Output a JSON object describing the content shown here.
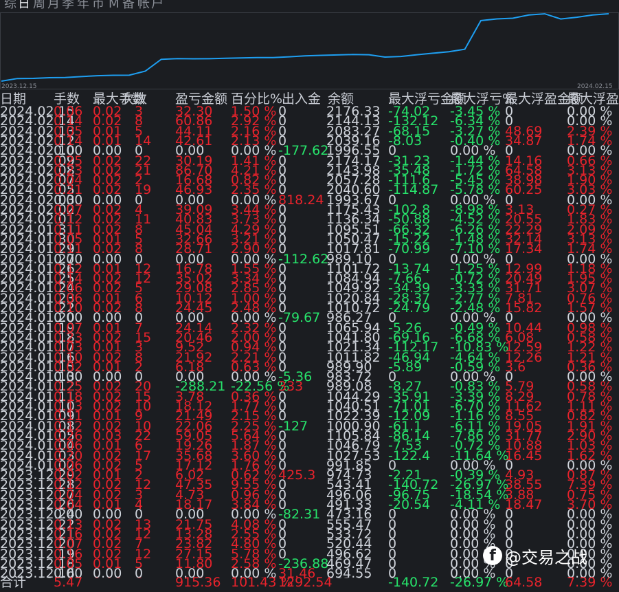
{
  "tabs": [
    "综",
    "日",
    "周",
    "月",
    "季",
    "年",
    "币",
    "M",
    "备",
    "帐",
    "户"
  ],
  "active_tab": 1,
  "chart": {
    "x_start": "2023.12.15",
    "x_end": "2024.02.15",
    "line_color": "#1e9ff2",
    "values": [
      400,
      469,
      473,
      491,
      496,
      520,
      543,
      554,
      555,
      663,
      974,
      992,
      989,
      990,
      1001,
      1010,
      1020,
      1021,
      1042,
      1065,
      1080,
      1090,
      1101,
      1095,
      1035,
      1050,
      1095,
      1136,
      1175,
      1240,
      1994,
      2040,
      2058,
      2144,
      2174,
      2039,
      2083,
      2144,
      2176
    ]
  },
  "headers": [
    "日期",
    "手数",
    "最大手数",
    "次数",
    "盈亏金额",
    "百分比%",
    "出入金",
    "余额",
    "最大浮亏金额",
    "最大浮亏%",
    "最大浮盈金额",
    "最大浮盈%"
  ],
  "colors": {
    "profit": "#e8232c",
    "loss": "#27e36b",
    "neutral": "#cfd3da",
    "background": "#1b1d21"
  },
  "rows": [
    [
      "2024.02.15",
      "0.06",
      "0.02",
      "3",
      "32.30",
      "1.50 %",
      "0",
      "2176.33",
      "-74.02",
      "-3.45 %",
      "0",
      "0.00 %"
    ],
    [
      "2024.02.14",
      "0.14",
      "0.02",
      "8",
      "60.86",
      "2.92 %",
      "0",
      "2144.13",
      "-132.12",
      "-6.34 %",
      "0",
      "0.00 %"
    ],
    [
      "2024.02.13",
      "0.05",
      "0.01",
      "5",
      "44.11",
      "2.16 %",
      "0",
      "2083.27",
      "-68.15",
      "-3.27 %",
      "48.69",
      "2.39 %"
    ],
    [
      "2024.02.12",
      "0.14",
      "0.01",
      "14",
      "42.61",
      "2.13 %",
      "0",
      "2039.16",
      "-8.03",
      "-0.40 %",
      "34.87",
      "1.74 %"
    ],
    [
      "2024.02.10",
      "0.00",
      "0.00",
      "0",
      "0.00",
      "0.00 %",
      "-177.62",
      "1996.55",
      "0",
      "0.00 %",
      "0",
      "0.00 %"
    ],
    [
      "2024.02.09",
      "0.25",
      "0.02",
      "22",
      "30.19",
      "1.41 %",
      "0",
      "2174.17",
      "-31.23",
      "-1.44 %",
      "14.16",
      "0.66 %"
    ],
    [
      "2024.02.08",
      "0.23",
      "0.02",
      "21",
      "86.70",
      "4.21 %",
      "0",
      "2143.98",
      "-35.48",
      "-1.72 %",
      "64.58",
      "3.13 %"
    ],
    [
      "2024.02.07",
      "0.04",
      "0.02",
      "2",
      "16.68",
      "0.82 %",
      "0",
      "2057.28",
      "-111.6",
      "-5.45 %",
      "38.98",
      "1.90 %"
    ],
    [
      "2024.02.05",
      "0.21",
      "0.02",
      "19",
      "46.93",
      "2.35 %",
      "0",
      "2040.60",
      "-114.87",
      "-5.78 %",
      "60.25",
      "3.03 %"
    ],
    [
      "2024.02.03",
      "0.00",
      "0.00",
      "0",
      "0.00",
      "0.00 %",
      "818.24",
      "1993.67",
      "0",
      "0.00 %",
      "0",
      "0.00 %"
    ],
    [
      "2024.02.02",
      "0.07",
      "0.02",
      "4",
      "39.09",
      "3.44 %",
      "0",
      "1175.43",
      "-102.8",
      "-8.98 %",
      "3.13",
      "0.27 %"
    ],
    [
      "2024.02.01",
      "0.12",
      "0.02",
      "11",
      "40.83",
      "3.73 %",
      "0",
      "1136.34",
      "-50.88",
      "-4.52 %",
      "20.55",
      "1.83 %"
    ],
    [
      "2024.01.31",
      "0.11",
      "0.02",
      "8",
      "45.04",
      "4.29 %",
      "0",
      "1095.51",
      "-66.32",
      "-6.26 %",
      "22.29",
      "2.09 %"
    ],
    [
      "2024.01.30",
      "0.05",
      "0.01",
      "5",
      "32.66",
      "3.21 %",
      "0",
      "1050.47",
      "-15.22",
      "-1.48 %",
      "32.14",
      "3.13 %"
    ],
    [
      "2024.01.29",
      "0.11",
      "0.02",
      "8",
      "28.71",
      "2.90 %",
      "0",
      "1017.81",
      "-70.99",
      "-7.10 %",
      "17.34",
      "1.74 %"
    ],
    [
      "2024.01.27",
      "0.00",
      "0.00",
      "0",
      "0.00",
      "0.00 %",
      "-112.62",
      "989.10",
      "0",
      "0.00 %",
      "0",
      "0.00 %"
    ],
    [
      "2024.01.26",
      "0.12",
      "0.01",
      "12",
      "16.78",
      "1.55 %",
      "0",
      "1101.72",
      "-13.74",
      "-1.25 %",
      "12.99",
      "1.18 %"
    ],
    [
      "2024.01.25",
      "0.14",
      "0.02",
      "12",
      "35.02",
      "3.34 %",
      "0",
      "1084.94",
      "-7.66",
      "-0.72 %",
      "20.49",
      "1.95 %"
    ],
    [
      "2024.01.24",
      "0.06",
      "0.02",
      "5",
      "29.08",
      "2.85 %",
      "0",
      "1049.92",
      "-34.39",
      "-3.33 %",
      "31.71",
      "3.07 %"
    ],
    [
      "2024.01.23",
      "0.06",
      "0.01",
      "6",
      "10.12",
      "1.00 %",
      "0",
      "1020.84",
      "-28.37",
      "-2.77 %",
      "7.81",
      "0.76 %"
    ],
    [
      "2024.01.22",
      "0.10",
      "0.02",
      "8",
      "24.45",
      "2.48 %",
      "0",
      "1010.72",
      "-24.79",
      "-2.48 %",
      "15.82",
      "1.57 %"
    ],
    [
      "2024.01.20",
      "0.00",
      "0.00",
      "0",
      "0.00",
      "0.00 %",
      "-79.67",
      "986.27",
      "0",
      "0.00 %",
      "0",
      "0.00 %"
    ],
    [
      "2024.01.19",
      "0.07",
      "0.01",
      "7",
      "24.14",
      "2.32 %",
      "0",
      "1065.94",
      "-5.26",
      "-0.49 %",
      "10.44",
      "0.98 %"
    ],
    [
      "2024.01.18",
      "0.23",
      "0.02",
      "15",
      "20.46",
      "2.00 %",
      "0",
      "1041.80",
      "-69.16",
      "-6.68 %",
      "6.08",
      "0.58 %"
    ],
    [
      "2024.01.17",
      "0.03",
      "0.01",
      "3",
      "9.52",
      "0.94 %",
      "0",
      "1021.34",
      "-112.17",
      "-10.83 %",
      "12.59",
      "1.22 %"
    ],
    [
      "2024.01.16",
      "0.10",
      "0.02",
      "8",
      "21.92",
      "2.21 %",
      "0",
      "1011.82",
      "-46.94",
      "-4.64 %",
      "12.26",
      "1.21 %"
    ],
    [
      "2024.01.15",
      "0.02",
      "0.01",
      "2",
      "6.18",
      "0.63 %",
      "0",
      "989.90",
      "-5.89",
      "-0.59 %",
      "3.6",
      "0.36 %"
    ],
    [
      "2024.01.13",
      "0.00",
      "0.00",
      "0",
      "0.00",
      "0.00 %",
      "-5.36",
      "983.72",
      "0",
      "0.00 %",
      "0",
      "0.00 %"
    ],
    [
      "2024.01.12",
      "0.25",
      "0.02",
      "20",
      "-288.21",
      "-22.56 %",
      "333",
      "989.08",
      "-8.27",
      "-0.83 %",
      "5.79",
      "0.58 %"
    ],
    [
      "2024.01.11",
      "0.18",
      "0.02",
      "15",
      "3.78",
      "0.36 %",
      "0",
      "1044.29",
      "-35.91",
      "-3.39 %",
      "8.29",
      "0.78 %"
    ],
    [
      "2024.01.10",
      "0.13",
      "0.02",
      "10",
      "18.12",
      "1.77 %",
      "0",
      "1040.51",
      "-71.01",
      "-6.70 %",
      "11.62",
      "1.11 %"
    ],
    [
      "2024.01.09",
      "0.11",
      "0.01",
      "9",
      "21.49",
      "2.15 %",
      "0",
      "1022.39",
      "-12.09",
      "-1.16 %",
      "8.55",
      "0.82 %"
    ],
    [
      "2024.01.08",
      "0.12",
      "0.02",
      "10",
      "22.06",
      "2.25 %",
      "-127",
      "1000.90",
      "-61.1",
      "-6.11 %",
      "19.05",
      "1.91 %"
    ],
    [
      "2024.01.05",
      "0.26",
      "0.03",
      "22",
      "59.05",
      "5.64 %",
      "0",
      "1105.84",
      "-86.14",
      "-7.86 %",
      "31.77",
      "2.90 %"
    ],
    [
      "2024.01.04",
      "0.06",
      "0.01",
      "6",
      "19.26",
      "1.87 %",
      "0",
      "1046.79",
      "-7.53",
      "-0.72 %",
      "10.88",
      "1.03 %"
    ],
    [
      "2024.01.03",
      "0.20",
      "0.02",
      "17",
      "35.68",
      "3.60 %",
      "0",
      "1027.53",
      "-122.4",
      "-11.64 %",
      "16.45",
      "1.62 %"
    ],
    [
      "2024.01.02",
      "0.06",
      "0.02",
      "5",
      "17.12",
      "1.76 %",
      "0",
      "991.85",
      "0",
      "0.00 %",
      "0",
      "0.00 %"
    ],
    [
      "2023.12.29",
      "0.02",
      "0.01",
      "2",
      "6.02",
      "0.62 %",
      "425.3",
      "974.73",
      "-2.21",
      "-0.39 %",
      "4.93",
      "0.87 %"
    ],
    [
      "2023.12.28",
      "0.12",
      "0.02",
      "12",
      "47.35",
      "9.55 %",
      "0",
      "543.41",
      "-140.72",
      "-26.97 %",
      "38.55",
      "7.39 %"
    ],
    [
      "2023.12.27",
      "0.04",
      "0.02",
      "3",
      "4.73",
      "0.96 %",
      "0",
      "496.06",
      "-96.75",
      "-18.54 %",
      "3.88",
      "0.75 %"
    ],
    [
      "2023.12.26",
      "0.04",
      "0.01",
      "4",
      "18.17",
      "3.84 %",
      "0",
      "491.33",
      "-20.54",
      "-4.11 %",
      "18.47",
      "3.70 %"
    ],
    [
      "2023.12.24",
      "0.00",
      "0.00",
      "0",
      "0.00",
      "0.00 %",
      "-82.31",
      "473.16",
      "0",
      "0.00 %",
      "0",
      "0.00 %"
    ],
    [
      "2023.12.22",
      "0.13",
      "0.02",
      "13",
      "21.75",
      "4.08 %",
      "0",
      "555.47",
      "0",
      "0.00 %",
      "0",
      "0.00 %"
    ],
    [
      "2023.12.21",
      "0.16",
      "0.02",
      "12",
      "13.28",
      "2.55 %",
      "0",
      "533.72",
      "0",
      "0.00 %",
      "0",
      "0.00 %"
    ],
    [
      "2023.12.20",
      "0.07",
      "0.02",
      "7",
      "23.82",
      "4.80 %",
      "0",
      "520.44",
      "0",
      "0.00 %",
      "0",
      "0.00 %"
    ],
    [
      "2023.12.19",
      "0.16",
      "0.02",
      "12",
      "27.15",
      "5.78 %",
      "0",
      "496.62",
      "0",
      "0.00 %",
      "0",
      "0.00 %"
    ],
    [
      "2023.12.18",
      "0.05",
      "0.01",
      "5",
      "11.80",
      "2.58 %",
      "-236.88",
      "469.47",
      "0",
      "0.00 %",
      "0",
      "0.00 %"
    ],
    [
      "2023.12.16",
      "0.00",
      "0.00",
      "0",
      "0.00",
      "0.00 %",
      "31.46",
      "694.55",
      "0",
      "0.00 %",
      "0",
      "0.00 %"
    ],
    [
      "2023.12.15",
      "0.13",
      "0.06",
      "6",
      "88.66",
      "15.43 %",
      "606",
      "663.09",
      "0",
      "0.00 %",
      "0",
      "0.00 %"
    ]
  ],
  "footer": [
    "合计",
    "5.47",
    "",
    "",
    "915.36",
    "101.43 %",
    "1292.54",
    "",
    "-140.72",
    "-26.97 %",
    "64.58",
    "7.39 %"
  ],
  "watermark": {
    "text": "@交易之战",
    "logo": "f"
  }
}
